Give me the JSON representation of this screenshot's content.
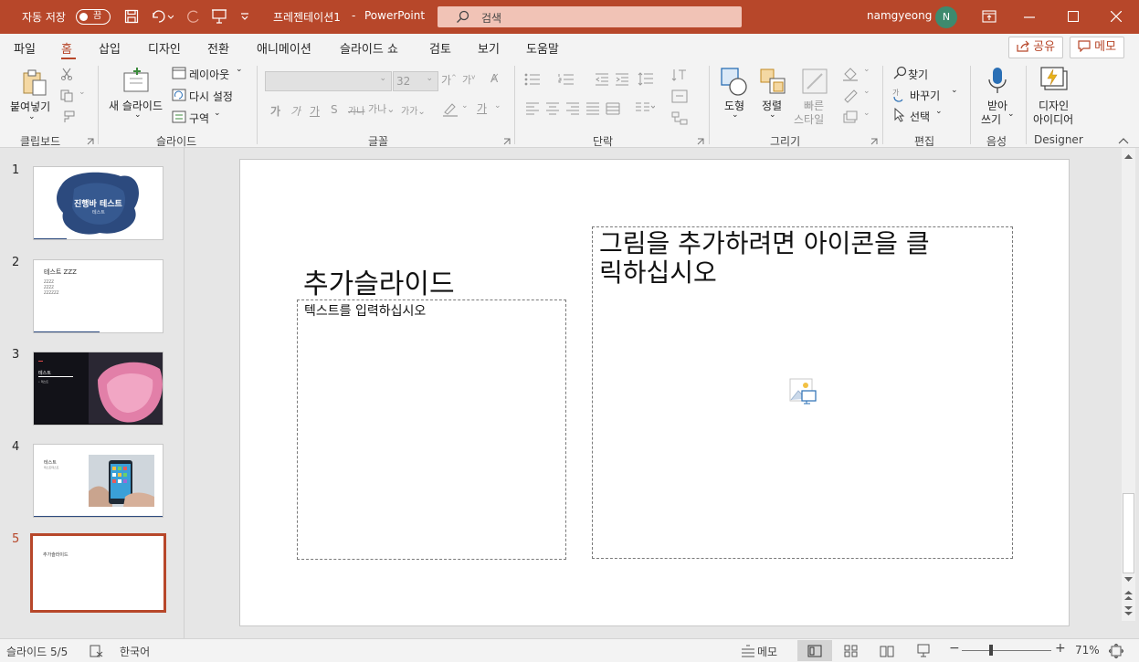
{
  "titlebar": {
    "autosave_label": "자동 저장",
    "autosave_state": "끔",
    "doc_title": "프레젠테이션1",
    "separator": "-",
    "app_name": "PowerPoint",
    "search_placeholder": "검색",
    "user_name": "namgyeong",
    "avatar_initial": "N",
    "brand_color": "#b7472a"
  },
  "tabs": [
    "파일",
    "홈",
    "삽입",
    "디자인",
    "전환",
    "애니메이션",
    "슬라이드 쇼",
    "검토",
    "보기",
    "도움말"
  ],
  "active_tab": "홈",
  "header_buttons": {
    "share": "공유",
    "comments": "메모"
  },
  "ribbon": {
    "clipboard": {
      "paste": "붙여넣기",
      "group": "클립보드"
    },
    "slides": {
      "new_slide_1": "새 슬라이드",
      "layout": "레이아웃",
      "reset": "다시 설정",
      "section": "구역",
      "group": "슬라이드"
    },
    "font": {
      "font_size": "32",
      "group": "글꼴"
    },
    "paragraph": {
      "group": "단락"
    },
    "drawing": {
      "shapes": "도형",
      "arrange": "정렬",
      "quick_styles_1": "빠른",
      "quick_styles_2": "스타일",
      "group": "그리기"
    },
    "editing": {
      "find": "찾기",
      "replace": "바꾸기",
      "select": "선택",
      "group": "편집"
    },
    "voice": {
      "dictate_1": "받아",
      "dictate_2": "쓰기",
      "group": "음성"
    },
    "designer": {
      "ideas_1": "디자인",
      "ideas_2": "아이디어",
      "group": "Designer"
    }
  },
  "thumbnails": [
    {
      "num": "1",
      "title": "진행바 테스트",
      "subtitle": "테스트"
    },
    {
      "num": "2",
      "title": "테스트 ZZZ",
      "bullets": [
        "ZZZZ",
        "ZZZZ",
        "ZZZZZZ"
      ]
    },
    {
      "num": "3",
      "title": "테스트",
      "bullet": "• 테스트"
    },
    {
      "num": "4",
      "title": "테스트",
      "sub": "테스트테스트"
    },
    {
      "num": "5",
      "title": "추가슬라이드"
    }
  ],
  "slide": {
    "title": "추가슬라이드",
    "text_placeholder": "텍스트를 입력하십시오",
    "picture_placeholder_1": "그림을 추가하려면 아이콘을 클",
    "picture_placeholder_2": "릭하십시오"
  },
  "statusbar": {
    "slide_counter": "슬라이드 5/5",
    "language": "한국어",
    "notes": "메모",
    "zoom": "71%",
    "zoom_level_percent": 71
  }
}
